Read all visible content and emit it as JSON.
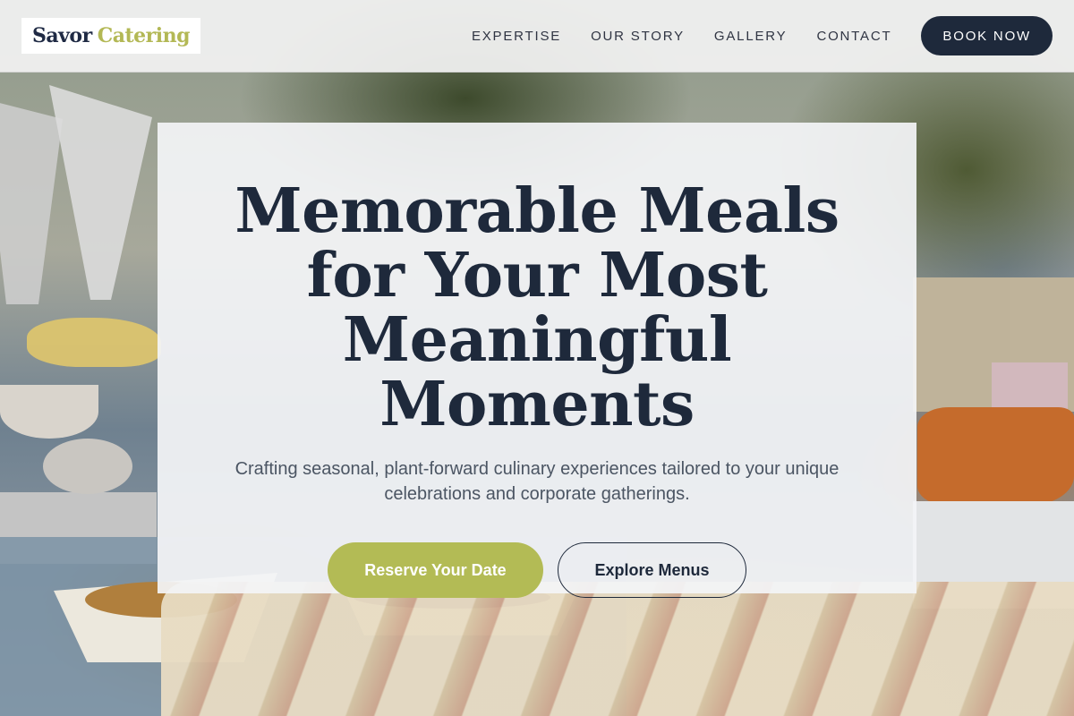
{
  "header": {
    "logo": {
      "word1": "Savor",
      "word2": "Catering"
    },
    "nav": [
      {
        "label": "EXPERTISE"
      },
      {
        "label": "OUR STORY"
      },
      {
        "label": "GALLERY"
      },
      {
        "label": "CONTACT"
      }
    ],
    "cta_label": "BOOK NOW"
  },
  "hero": {
    "title": "Memorable Meals for Your Most Meaningful Moments",
    "subtitle": "Crafting seasonal, plant-forward culinary experiences tailored to your unique celebrations and corporate gatherings.",
    "primary_button": "Reserve Your Date",
    "secondary_button": "Explore Menus"
  },
  "colors": {
    "navy": "#1e293b",
    "accent_olive": "#b3bb55",
    "text_gray": "#4b5563"
  }
}
